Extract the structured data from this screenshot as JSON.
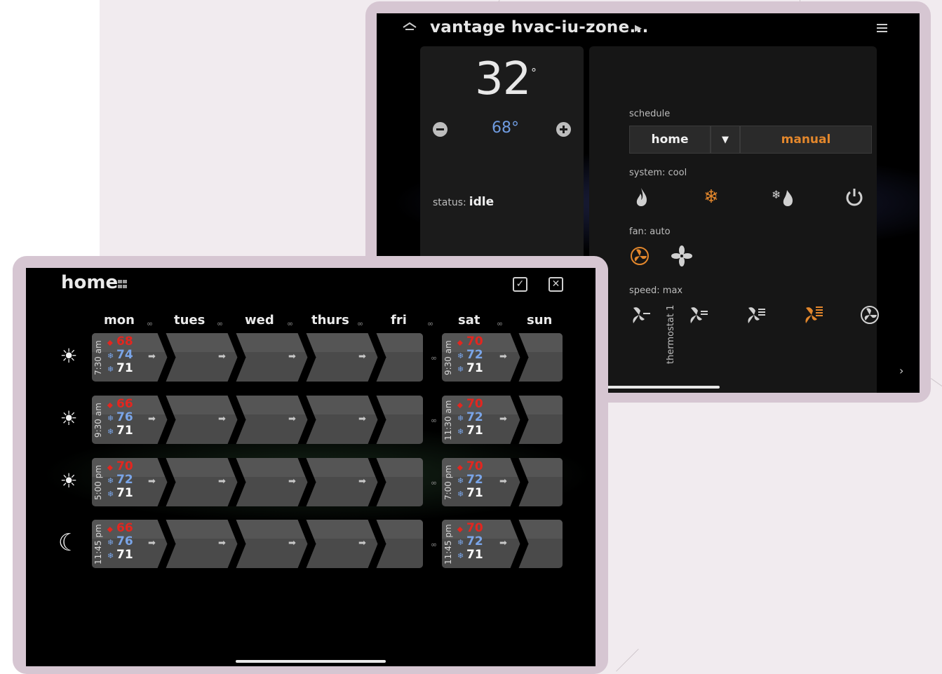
{
  "thermostat": {
    "title": "vantage hvac-iu-zone...",
    "current_temp": "32",
    "degree": "°",
    "setpoint": "68°",
    "status_label": "status:",
    "status_value": "idle",
    "schedule_label": "schedule",
    "schedule_value": "home",
    "schedule_dropdown": "▼",
    "mode_button": "manual",
    "system_label": "system:  cool",
    "fan_label": "fan:  auto",
    "speed_label": "speed:  max",
    "side_label": "thermostat 1",
    "side_arrow": "›",
    "icons": {
      "home": "home-icon",
      "menu": "menu-icon",
      "title_arrow": "play-arrow-icon",
      "minus": "minus-circle-icon",
      "plus": "plus-circle-icon",
      "system": [
        "flame-icon",
        "snowflake-icon",
        "snowflake-flame-icon",
        "power-icon"
      ],
      "fan": [
        "fan-auto-icon",
        "fan-on-icon"
      ],
      "speed": [
        "fan-speed-1-icon",
        "fan-speed-2-icon",
        "fan-speed-3-icon",
        "fan-speed-max-icon",
        "fan-speed-auto-icon"
      ]
    },
    "colors": {
      "accent": "#e3872c",
      "setpoint": "#6f9be0"
    }
  },
  "schedule": {
    "title": "home",
    "confirm_icon": "checkbox-check-icon",
    "close_icon": "checkbox-close-icon",
    "days": [
      "mon",
      "tues",
      "wed",
      "thurs",
      "fri",
      "sat",
      "sun"
    ],
    "link_symbol": "∞",
    "arrow": "➡",
    "weekday_rows": [
      {
        "icon": "sun-icon",
        "time": "7:30 am",
        "heat": "68",
        "cool": "74",
        "auto": "71"
      },
      {
        "icon": "sun-icon",
        "time": "9:30 am",
        "heat": "66",
        "cool": "76",
        "auto": "71"
      },
      {
        "icon": "sun-icon",
        "time": "5:00 pm",
        "heat": "70",
        "cool": "72",
        "auto": "71"
      },
      {
        "icon": "moon-icon",
        "time": "11:45 pm",
        "heat": "66",
        "cool": "76",
        "auto": "71"
      }
    ],
    "weekend_rows": [
      {
        "time": "9:30 am",
        "heat": "70",
        "cool": "72",
        "auto": "71"
      },
      {
        "time": "11:30 am",
        "heat": "70",
        "cool": "72",
        "auto": "71"
      },
      {
        "time": "7:00 pm",
        "heat": "70",
        "cool": "72",
        "auto": "71"
      },
      {
        "time": "11:45 pm",
        "heat": "70",
        "cool": "72",
        "auto": "71"
      }
    ],
    "colors": {
      "heat": "#e4261f",
      "cool": "#7aa5e8",
      "auto": "#ffffff"
    }
  }
}
